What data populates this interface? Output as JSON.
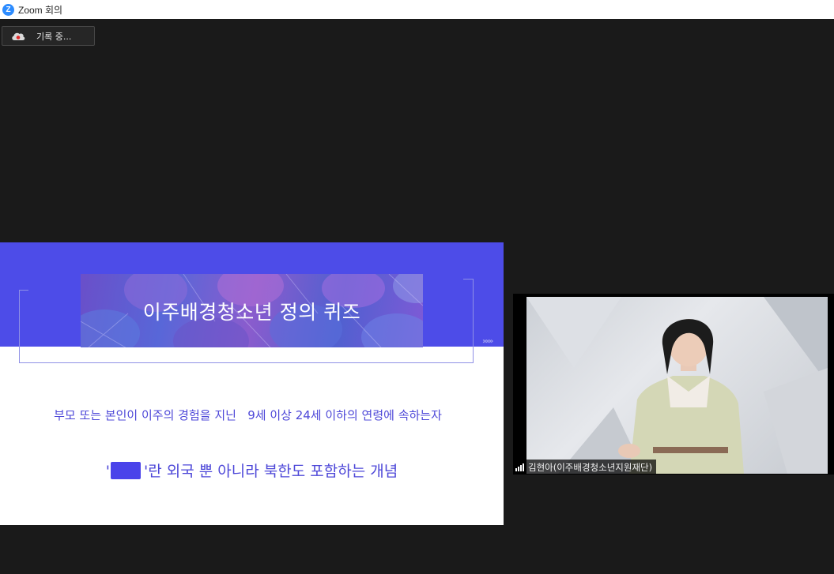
{
  "window": {
    "app_icon": "zoom-logo-icon",
    "title": "Zoom 회의"
  },
  "recording": {
    "icon": "cloud-record-icon",
    "label": "기록 중..."
  },
  "slide": {
    "title": "이주배경청소년 정의 퀴즈",
    "definition": "부모 또는 본인이 이주의 경험을 지닌   9세 이상 24세 이하의 연령에 속하는자",
    "concept_prefix": "'",
    "concept_suffix": "'란 외국 뿐 아니라 북한도 포함하는 개념",
    "chevrons": "»»»",
    "colors": {
      "band": "#4d4ce8",
      "text": "#4d47d8",
      "blank": "#4a43ea"
    }
  },
  "participant": {
    "name": "김현아(이주배경청소년지원재단)",
    "signal_icon": "signal-strength-icon"
  }
}
